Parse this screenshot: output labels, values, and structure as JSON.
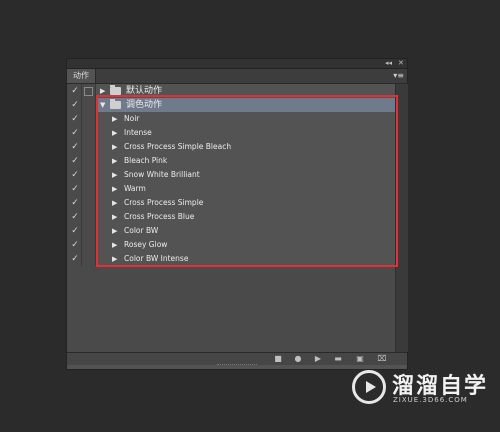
{
  "panel": {
    "title_controls": {
      "collapse": "◂◂",
      "close": "✕"
    },
    "tab_label": "动作",
    "menu_icon": "panel-menu-icon"
  },
  "actions": {
    "sets": [
      {
        "name": "默认动作",
        "expanded": false,
        "checked": true
      },
      {
        "name": "调色动作",
        "expanded": true,
        "checked": true,
        "selected": true
      }
    ],
    "items": [
      {
        "name": "Noir",
        "checked": true
      },
      {
        "name": "Intense",
        "checked": true
      },
      {
        "name": "Cross Process Simple Bleach",
        "checked": true
      },
      {
        "name": "Bleach Pink",
        "checked": true
      },
      {
        "name": "Snow White Brilliant",
        "checked": true
      },
      {
        "name": "Warm",
        "checked": true
      },
      {
        "name": "Cross Process Simple",
        "checked": true
      },
      {
        "name": "Cross Process Blue",
        "checked": true
      },
      {
        "name": "Color BW",
        "checked": true
      },
      {
        "name": "Rosey Glow",
        "checked": true
      },
      {
        "name": "Color BW Intense",
        "checked": true
      }
    ]
  },
  "toolbar": {
    "buttons": [
      "stop-icon",
      "record-icon",
      "play-icon",
      "new-set-icon",
      "new-action-icon",
      "delete-icon"
    ]
  },
  "watermark": {
    "title": "溜溜自学",
    "subtitle": "ZIXUE.3D66.COM"
  },
  "colors": {
    "highlight": "#e0313a",
    "selected_row": "#6f7a8c",
    "panel_bg": "#535353"
  }
}
